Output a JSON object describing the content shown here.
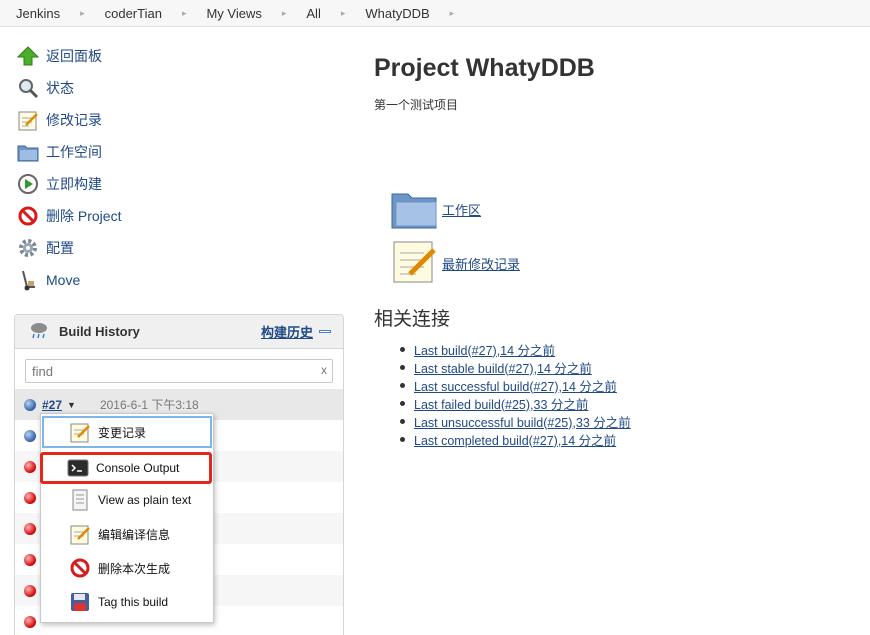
{
  "breadcrumb": [
    "Jenkins",
    "coderTian",
    "My Views",
    "All",
    "WhatyDDB"
  ],
  "tasks": [
    {
      "label": "返回面板",
      "icon": "up-arrow-icon"
    },
    {
      "label": "状态",
      "icon": "search-icon"
    },
    {
      "label": "修改记录",
      "icon": "notepad-icon"
    },
    {
      "label": "工作空间",
      "icon": "folder-icon"
    },
    {
      "label": "立即构建",
      "icon": "clock-icon"
    },
    {
      "label": "删除 Project",
      "icon": "no-entry-icon"
    },
    {
      "label": "配置",
      "icon": "gear-icon"
    },
    {
      "label": "Move",
      "icon": "hand-truck-icon"
    }
  ],
  "build_history": {
    "title": "Build History",
    "trend_link": "构建历史",
    "filter_placeholder": "find",
    "clear_symbol": "x",
    "builds": [
      {
        "number": "#27",
        "date": "2016-6-1 下午3:18",
        "status": "blue"
      },
      {
        "status": "blue"
      },
      {
        "status": "red"
      },
      {
        "status": "red"
      },
      {
        "status": "red"
      },
      {
        "status": "red"
      },
      {
        "status": "red"
      },
      {
        "status": "red"
      }
    ]
  },
  "context_menu": [
    {
      "label": "变更记录",
      "icon": "notepad-icon"
    },
    {
      "label": "Console Output",
      "icon": "terminal-icon"
    },
    {
      "label": "View as plain text",
      "icon": "document-icon"
    },
    {
      "label": "编辑编译信息",
      "icon": "notepad-icon"
    },
    {
      "label": "删除本次生成",
      "icon": "no-entry-icon"
    },
    {
      "label": "Tag this build",
      "icon": "floppy-disk-icon"
    }
  ],
  "project": {
    "title": "Project WhatyDDB",
    "description": "第一个测试项目",
    "workspace_link": "工作区",
    "changes_link": "最新修改记录",
    "related_title": "相关连接",
    "related_links": [
      "Last build(#27),14 分之前",
      "Last stable build(#27),14 分之前",
      "Last successful build(#27),14 分之前",
      "Last failed build(#25),33 分之前",
      "Last unsuccessful build(#25),33 分之前",
      "Last completed build(#27),14 分之前"
    ]
  },
  "colors": {
    "link": "#204a87",
    "highlight": "#e4271c",
    "focus": "#7fb6e8"
  }
}
